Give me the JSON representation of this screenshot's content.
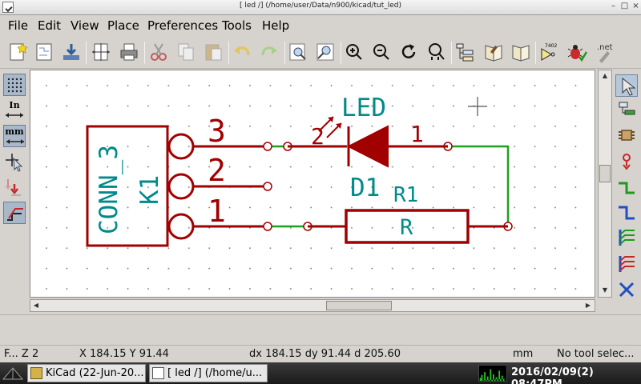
{
  "window": {
    "title": "[ led /] (/home/user/Data/n900/kicad/tut_led)"
  },
  "menu": [
    "File",
    "Edit",
    "View",
    "Place",
    "Preferences",
    "Tools",
    "Help"
  ],
  "left_toolbar": {
    "units_in": "In",
    "units_mm": "mm"
  },
  "schematic": {
    "connector_ref": "K1",
    "connector_value": "CONN_3",
    "pins": [
      "3",
      "2",
      "1"
    ],
    "led_value": "LED",
    "led_ref": "D1",
    "led_pin1": "1",
    "led_pin2": "2",
    "resistor_ref": "R1",
    "resistor_value": "R"
  },
  "status": {
    "zoom": "F... Z 2",
    "cursor": "X 184.15  Y 91.44",
    "delta": "dx 184.15  dy 91.44  d 205.60",
    "units": "mm",
    "tool": "No tool selec..."
  },
  "taskbar": {
    "items": [
      "KiCad (22-Jun-20...",
      "[ led /] (/home/u..."
    ],
    "clock": "2016/02/09(2) 08:47PM"
  },
  "colors": {
    "component": "#a00000",
    "reference": "#008a8a",
    "wire": "#00a000",
    "background": "#ffffff"
  }
}
